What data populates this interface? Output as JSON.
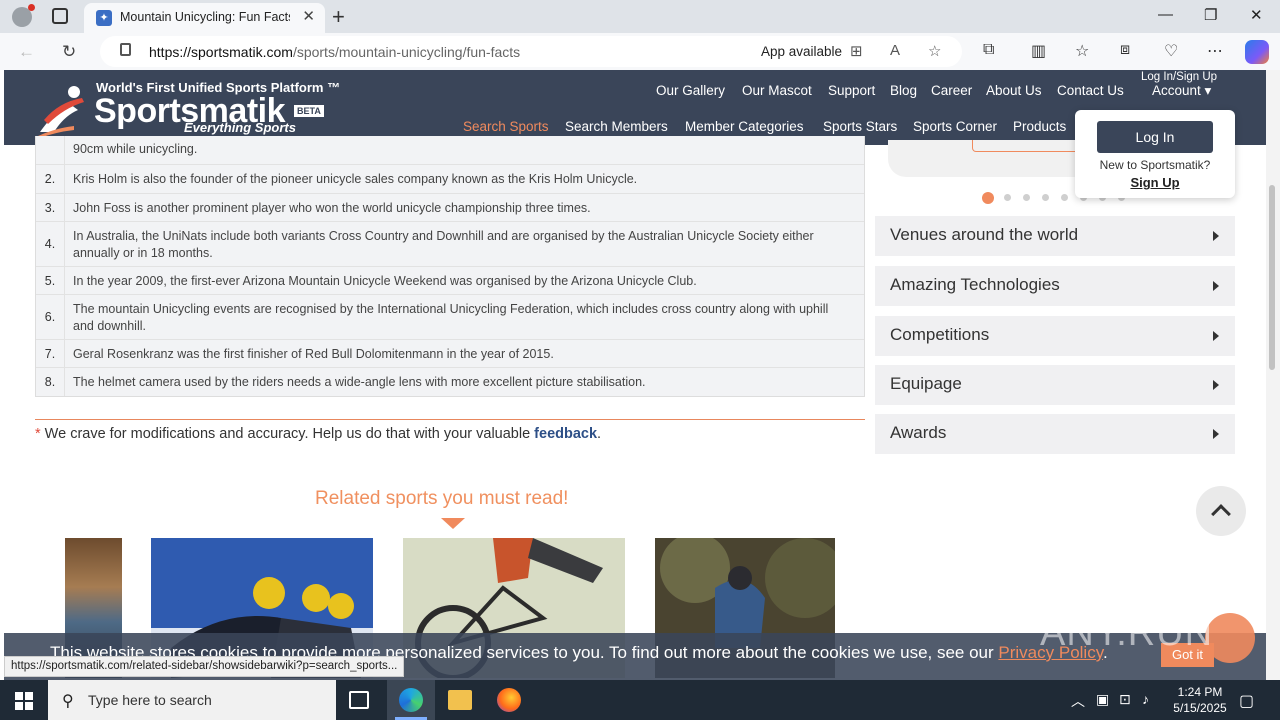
{
  "browser": {
    "tab_title": "Mountain Unicycling: Fun Facts,",
    "url_domain": "https://sportsmatik.com",
    "url_path": "/sports/mountain-unicycling/fun-facts",
    "app_available": "App available"
  },
  "header": {
    "logo_top": "World's First Unified Sports Platform ™",
    "logo_main": "Sportsmatik",
    "logo_beta": "BETA",
    "logo_tag": "Everything Sports",
    "login_signup": "Log In/Sign Up",
    "account": "Account",
    "topnav": [
      "Our Gallery",
      "Our Mascot",
      "Support",
      "Blog",
      "Career",
      "About Us",
      "Contact Us"
    ],
    "mainnav": [
      "Search Sports",
      "Search Members",
      "Member Categories",
      "Sports Stars",
      "Sports Corner",
      "Products"
    ]
  },
  "facts": [
    {
      "num": "",
      "text": "90cm while unicycling."
    },
    {
      "num": "2.",
      "text": "Kris Holm is also the founder of the pioneer unicycle sales company known as the Kris Holm Unicycle."
    },
    {
      "num": "3.",
      "text": "John Foss is another prominent player who won the world unicycle championship three times."
    },
    {
      "num": "4.",
      "text": "In Australia, the UniNats include both variants Cross Country and Downhill and are organised by the Australian Unicycle Society either annually or in 18 months."
    },
    {
      "num": "5.",
      "text": "In the year 2009, the first-ever Arizona Mountain Unicycle Weekend was organised by the Arizona Unicycle Club."
    },
    {
      "num": "6.",
      "text": "The mountain Unicycling events are recognised by the International Unicycling Federation, which includes cross country along with uphill and downhill."
    },
    {
      "num": "7.",
      "text": "Geral Rosenkranz was the first finisher of Red Bull Dolomitenmann in the year of 2015."
    },
    {
      "num": "8.",
      "text": "The helmet camera used by the riders needs a wide-angle lens with more excellent picture stabilisation."
    }
  ],
  "feedback": {
    "star": "*",
    "text": " We crave for modifications and accuracy. Help us do that with your valuable ",
    "link": "feedback",
    "end": "."
  },
  "related_title": "Related sports you must read!",
  "sidebar": {
    "items": [
      "Venues around the world",
      "Amazing Technologies",
      "Competitions",
      "Equipage",
      "Awards"
    ]
  },
  "login_dropdown": {
    "button": "Log In",
    "question": "New to Sportsmatik?",
    "signup": "Sign Up"
  },
  "cookie": {
    "message": "This website stores cookies to provide more personalized services to you. To find out more about the cookies we use, see our ",
    "policy_link": "Privacy Policy",
    "end": ".",
    "button": "Got it"
  },
  "status_url": "https://sportsmatik.com/related-sidebar/showsidebarwiki?p=search_sports...",
  "watermark": "ANY.RUN",
  "taskbar": {
    "search_placeholder": "Type here to search",
    "time": "1:24 PM",
    "date": "5/15/2025"
  },
  "colors": {
    "header_bg": "#3a4559",
    "accent": "#f08a5d",
    "link": "#2d4f87"
  }
}
